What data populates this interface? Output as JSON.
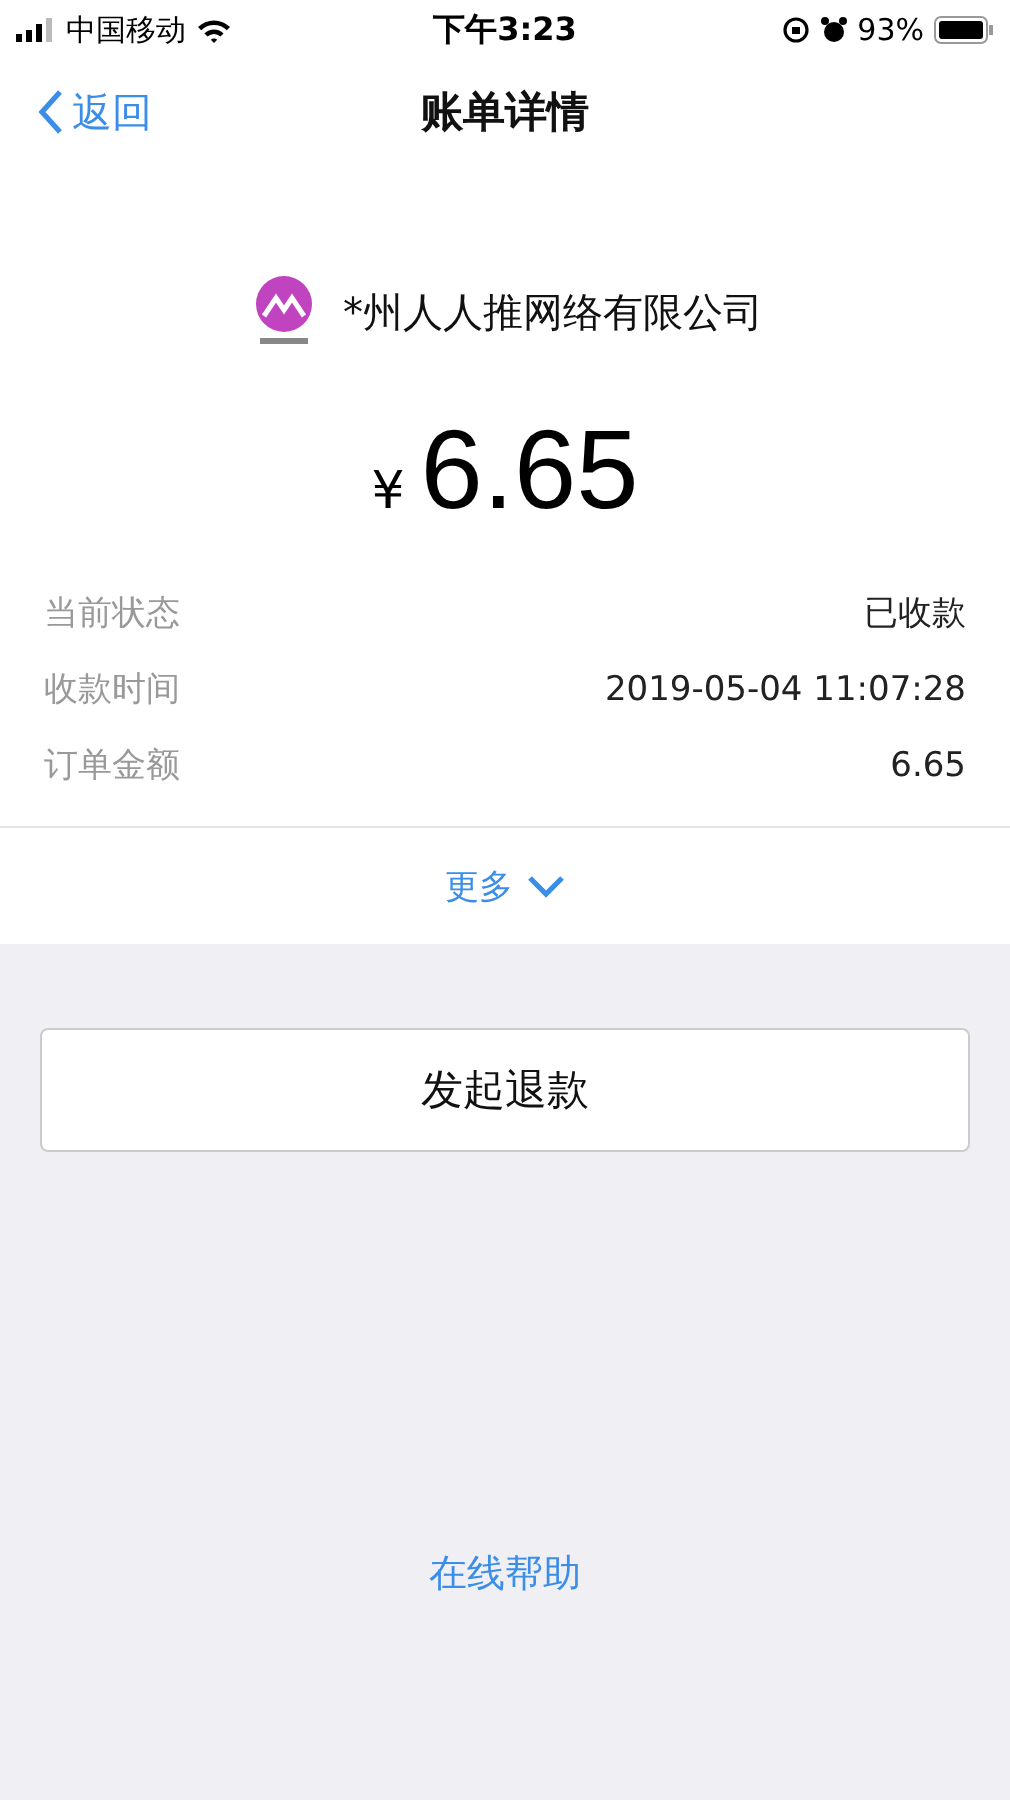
{
  "status_bar": {
    "carrier": "中国移动",
    "time": "下午3:23",
    "battery": "93%"
  },
  "nav": {
    "back": "返回",
    "title": "账单详情"
  },
  "merchant": {
    "name": "*州人人推网络有限公司"
  },
  "amount": {
    "currency": "¥",
    "value": "6.65"
  },
  "details": [
    {
      "label": "当前状态",
      "value": "已收款"
    },
    {
      "label": "收款时间",
      "value": "2019-05-04 11:07:28"
    },
    {
      "label": "订单金额",
      "value": "6.65"
    }
  ],
  "more": {
    "label": "更多"
  },
  "refund_button": "发起退款",
  "help_link": "在线帮助"
}
